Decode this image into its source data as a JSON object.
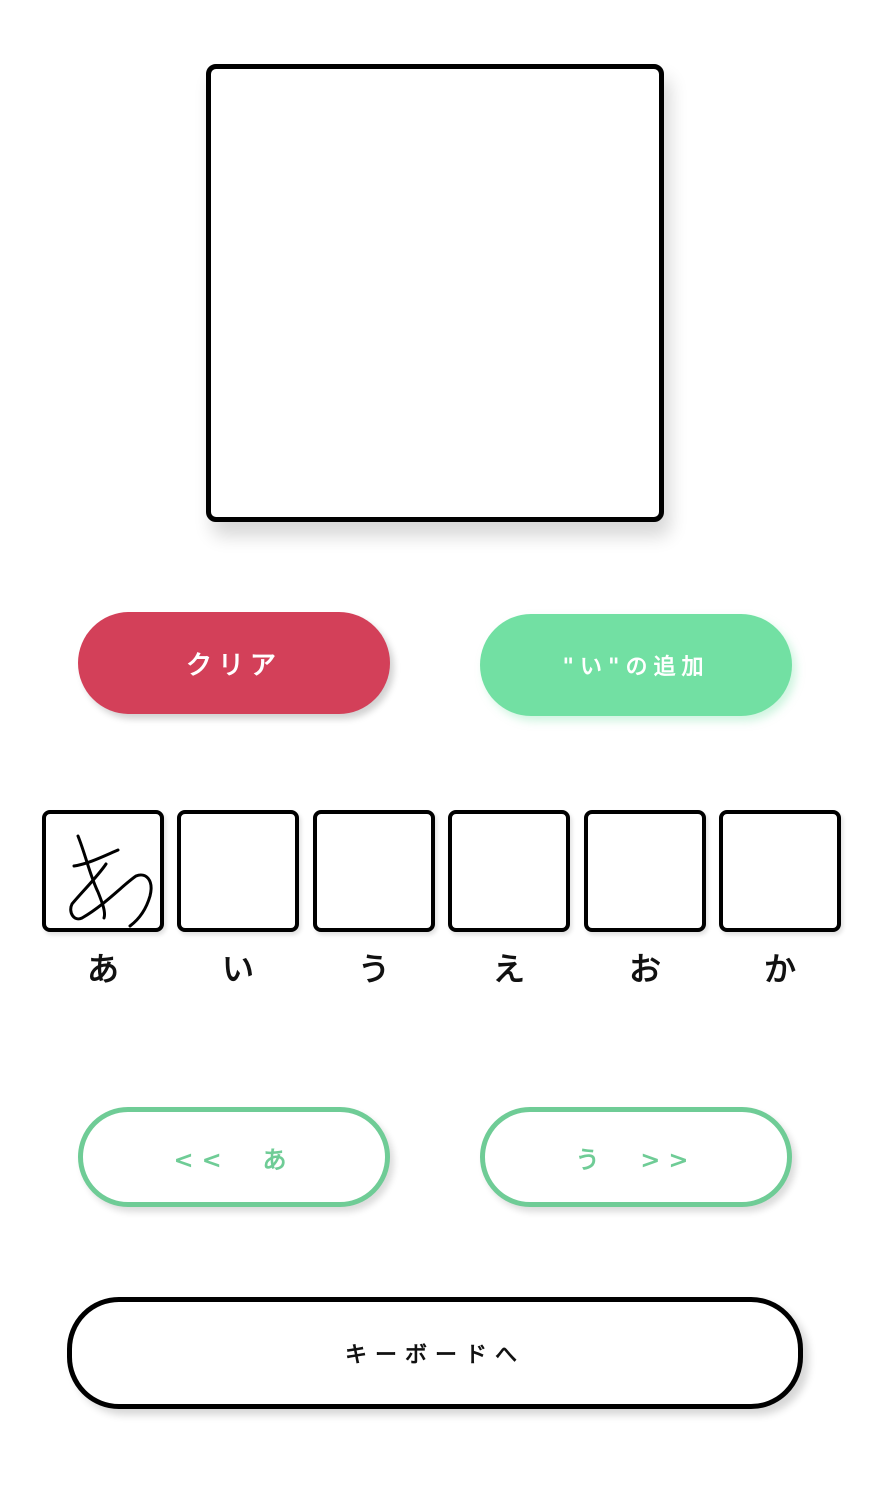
{
  "canvas": {
    "label": ""
  },
  "actions": {
    "clear_label": "クリア",
    "add_label": "\"い\"の追加"
  },
  "slots": [
    {
      "char": "あ",
      "has_drawing": true
    },
    {
      "char": "い",
      "has_drawing": false
    },
    {
      "char": "う",
      "has_drawing": false
    },
    {
      "char": "え",
      "has_drawing": false
    },
    {
      "char": "お",
      "has_drawing": false
    },
    {
      "char": "か",
      "has_drawing": false
    }
  ],
  "navigation": {
    "prev_label": "<<  あ",
    "next_label": "う  >>"
  },
  "keyboard": {
    "label": "キーボードへ"
  },
  "colors": {
    "clear": "#d34059",
    "add": "#72e0a3",
    "nav": "#6fcc96",
    "border": "#000000"
  }
}
